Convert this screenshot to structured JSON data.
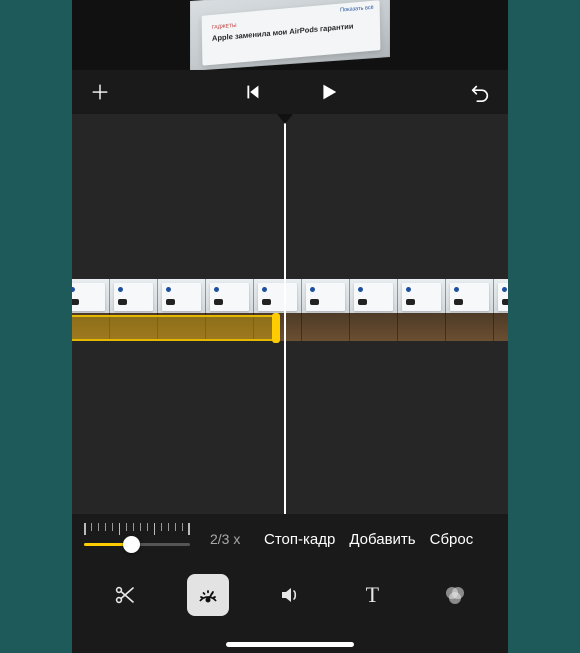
{
  "preview": {
    "tag": "ГАДЖЕТЫ",
    "headline": "Apple заменила мои AirPods",
    "subline": "гарантии",
    "link": "Показать всё"
  },
  "transport": {
    "add_icon": "plus-icon",
    "prev_icon": "skip-back-icon",
    "play_icon": "play-icon",
    "undo_icon": "undo-icon"
  },
  "speed": {
    "value_label": "2/3 x",
    "actions": {
      "freeze": "Стоп-кадр",
      "add": "Добавить",
      "reset": "Сброс"
    }
  },
  "tools": {
    "cut": "scissors-icon",
    "speed": "speedometer-icon",
    "volume": "speaker-icon",
    "text": "T",
    "filters": "filters-icon"
  },
  "colors": {
    "accent": "#ffcc00",
    "background": "#1a1a1a"
  }
}
